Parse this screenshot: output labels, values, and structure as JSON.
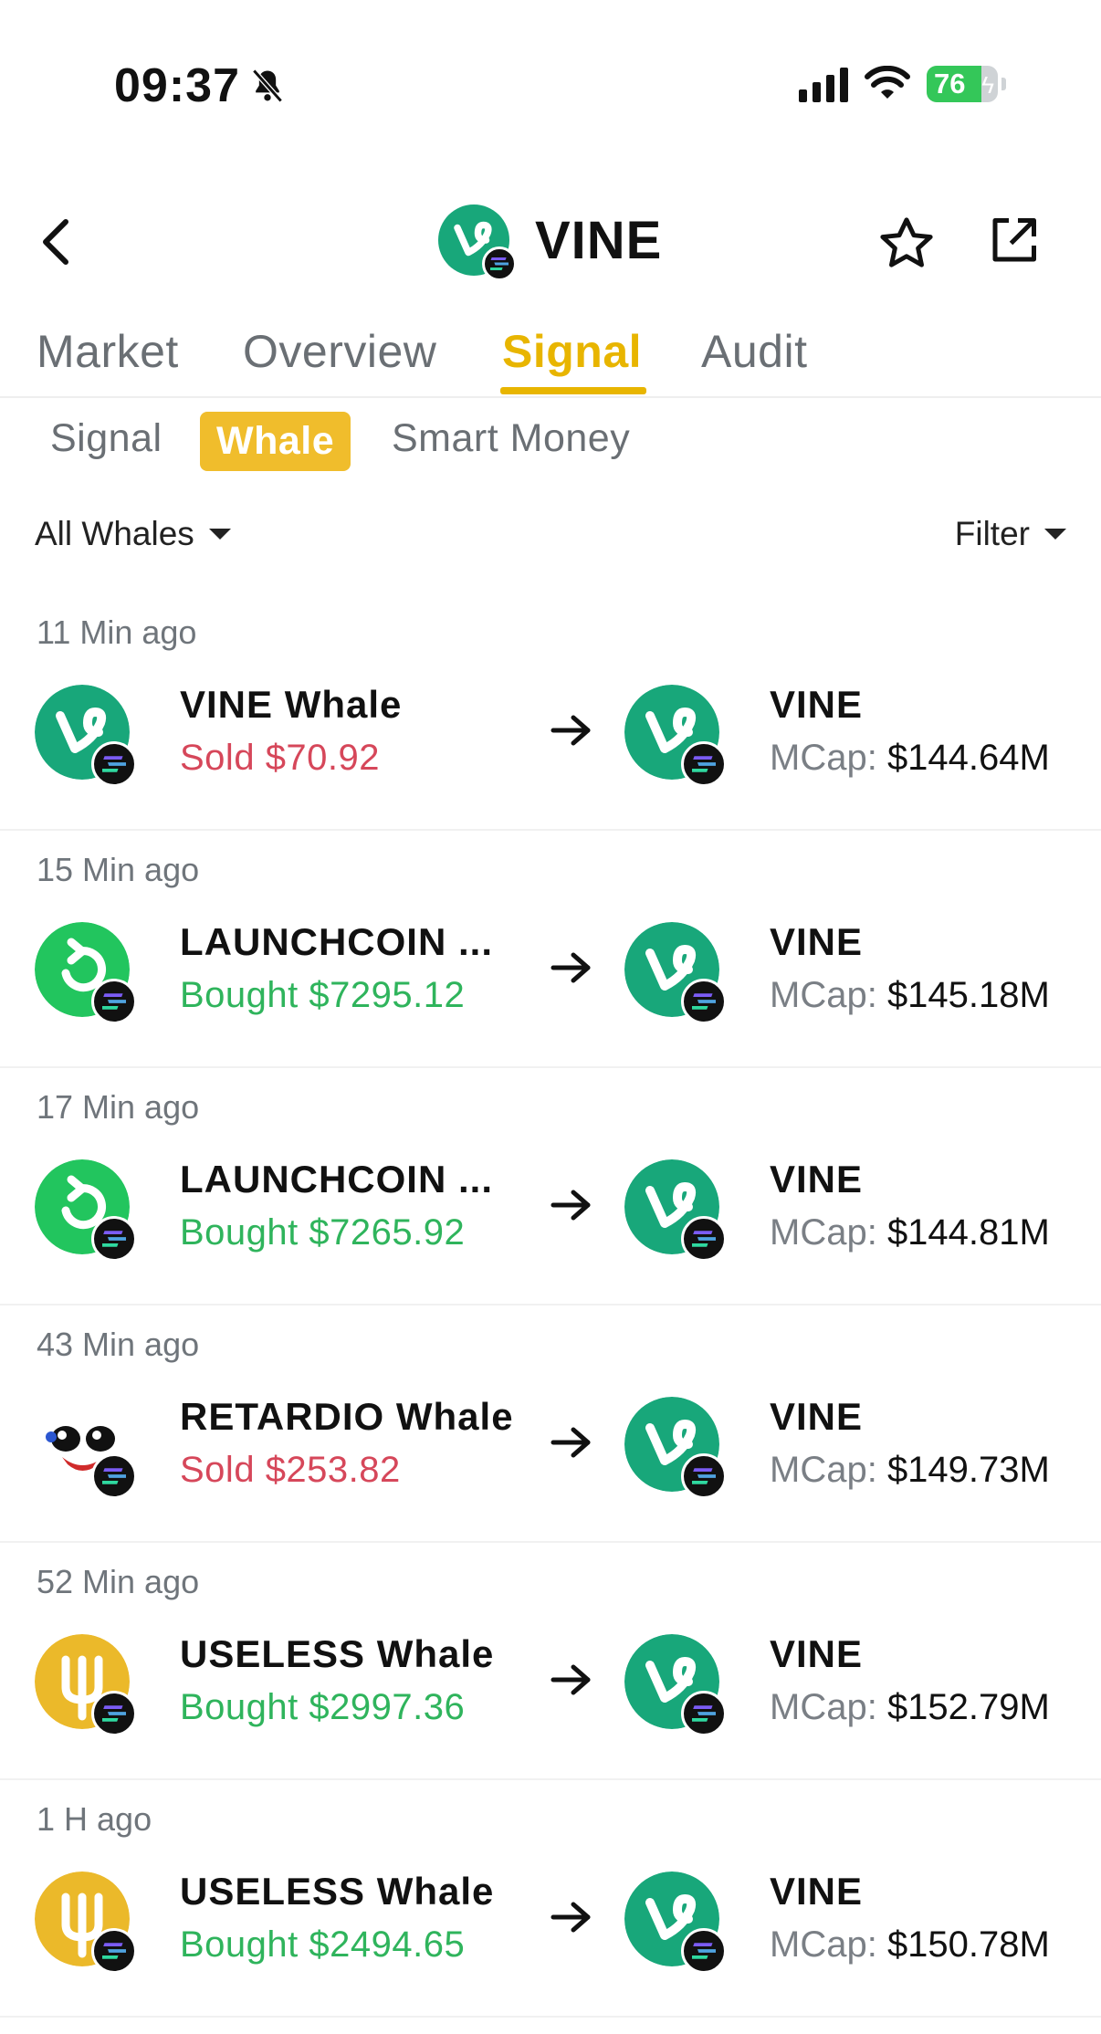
{
  "status_bar": {
    "time": "09:37",
    "battery": "76",
    "icons": [
      "bell-slash-icon",
      "cellular-signal-icon",
      "wifi-icon",
      "battery-icon"
    ]
  },
  "header": {
    "title": "VINE",
    "icons": [
      "back-chevron-icon",
      "vine-logo-icon",
      "star-icon",
      "share-icon"
    ]
  },
  "tabs": [
    "Market",
    "Overview",
    "Signal",
    "Audit"
  ],
  "active_tab": "Signal",
  "subtabs": [
    "Signal",
    "Whale",
    "Smart Money"
  ],
  "active_subtab": "Whale",
  "filters": {
    "left": "All Whales",
    "right": "Filter"
  },
  "feed": [
    {
      "time_ago": "11 Min ago",
      "whale": "VINE Whale",
      "action": "Sold",
      "amount": "$70.92",
      "target": "VINE",
      "mcap_label": "MCap:",
      "mcap": "$144.64M",
      "from_icon": "vine-logo-icon"
    },
    {
      "time_ago": "15 Min ago",
      "whale": "LAUNCHCOIN ...",
      "action": "Bought",
      "amount": "$7295.12",
      "target": "VINE",
      "mcap_label": "MCap:",
      "mcap": "$145.18M",
      "from_icon": "launchcoin-logo-icon"
    },
    {
      "time_ago": "17 Min ago",
      "whale": "LAUNCHCOIN ...",
      "action": "Bought",
      "amount": "$7265.92",
      "target": "VINE",
      "mcap_label": "MCap:",
      "mcap": "$144.81M",
      "from_icon": "launchcoin-logo-icon"
    },
    {
      "time_ago": "43 Min ago",
      "whale": "RETARDIO Whale",
      "action": "Sold",
      "amount": "$253.82",
      "target": "VINE",
      "mcap_label": "MCap:",
      "mcap": "$149.73M",
      "from_icon": "retardio-logo-icon"
    },
    {
      "time_ago": "52 Min ago",
      "whale": "USELESS Whale",
      "action": "Bought",
      "amount": "$2997.36",
      "target": "VINE",
      "mcap_label": "MCap:",
      "mcap": "$152.79M",
      "from_icon": "useless-logo-icon"
    },
    {
      "time_ago": "1 H ago",
      "whale": "USELESS Whale",
      "action": "Bought",
      "amount": "$2494.65",
      "target": "VINE",
      "mcap_label": "MCap:",
      "mcap": "$150.78M",
      "from_icon": "useless-logo-icon"
    }
  ],
  "colors": {
    "accent": "#e8b500",
    "subtab_active_bg": "#f0bd2c",
    "sold": "#d6475a",
    "bought": "#2fb45c",
    "vine_green": "#18a77a",
    "launchcoin_green": "#22c55e",
    "useless_yellow": "#ebb92a"
  }
}
